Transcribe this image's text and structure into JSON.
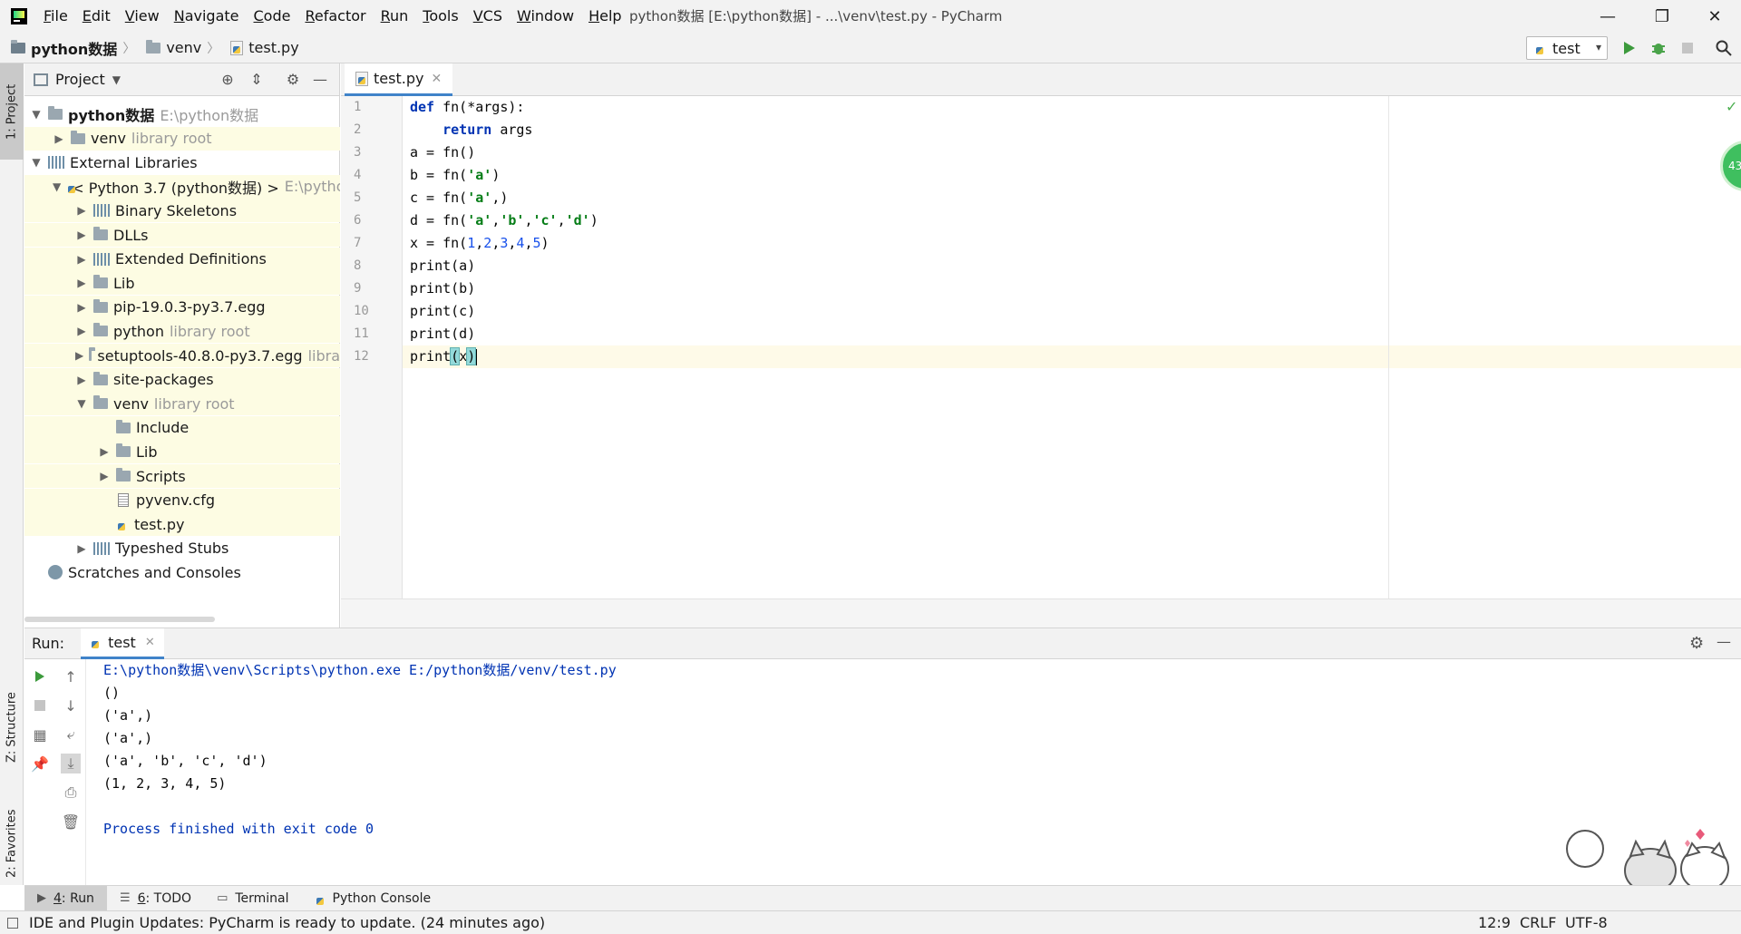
{
  "window": {
    "title": "python数据 [E:\\python数据] - ...\\venv\\test.py - PyCharm",
    "menu": [
      {
        "label_u": "F",
        "label_rest": "ile"
      },
      {
        "label_u": "E",
        "label_rest": "dit"
      },
      {
        "label_u": "V",
        "label_rest": "iew"
      },
      {
        "label_u": "N",
        "label_rest": "avigate"
      },
      {
        "label_u": "C",
        "label_rest": "ode"
      },
      {
        "label_u": "R",
        "label_rest": "efactor"
      },
      {
        "label_u": "R",
        "label_rest": "un"
      },
      {
        "label_u": "T",
        "label_rest": "ools"
      },
      {
        "label_u": "V",
        "label_rest": "CS"
      },
      {
        "label_u": "W",
        "label_rest": "indow"
      },
      {
        "label_u": "H",
        "label_rest": "elp"
      }
    ],
    "controls": {
      "minimize": "—",
      "restore": "❐",
      "close": "✕"
    }
  },
  "navbar": {
    "crumbs": [
      "python数据",
      "venv",
      "test.py"
    ],
    "run_config": "test",
    "icons": [
      "run-icon",
      "debug-icon",
      "stop-icon",
      "search-icon"
    ]
  },
  "left_strip": {
    "project": "1: Project",
    "structure": "Z: Structure",
    "favorites": "2: Favorites"
  },
  "project_panel": {
    "title": "Project",
    "tree": [
      {
        "name": "python数据",
        "hint": "E:\\python数据",
        "icon": "folder",
        "chev": "open"
      },
      {
        "name": "venv",
        "hint": "library root",
        "icon": "folder",
        "chev": "closed"
      },
      {
        "name": "External Libraries",
        "hint": "",
        "icon": "library",
        "chev": "open"
      },
      {
        "name": "< Python 3.7 (python数据) >",
        "hint": "E:\\pytho",
        "icon": "python",
        "chev": "open"
      },
      {
        "name": "Binary Skeletons",
        "hint": "",
        "icon": "library",
        "chev": "closed"
      },
      {
        "name": "DLLs",
        "hint": "",
        "icon": "folder",
        "chev": "closed"
      },
      {
        "name": "Extended Definitions",
        "hint": "",
        "icon": "library",
        "chev": "closed"
      },
      {
        "name": "Lib",
        "hint": "",
        "icon": "folder",
        "chev": "closed"
      },
      {
        "name": "pip-19.0.3-py3.7.egg",
        "hint": "",
        "icon": "folder",
        "chev": "closed"
      },
      {
        "name": "python",
        "hint": "library root",
        "icon": "folder",
        "chev": "closed"
      },
      {
        "name": "setuptools-40.8.0-py3.7.egg",
        "hint": "libra",
        "icon": "folder",
        "chev": "closed"
      },
      {
        "name": "site-packages",
        "hint": "",
        "icon": "folder",
        "chev": "closed"
      },
      {
        "name": "venv",
        "hint": "library root",
        "icon": "folder",
        "chev": "open"
      },
      {
        "name": "Include",
        "hint": "",
        "icon": "folder",
        "chev": "none"
      },
      {
        "name": "Lib",
        "hint": "",
        "icon": "folder",
        "chev": "closed"
      },
      {
        "name": "Scripts",
        "hint": "",
        "icon": "folder",
        "chev": "closed"
      },
      {
        "name": "pyvenv.cfg",
        "hint": "",
        "icon": "cfg",
        "chev": "none"
      },
      {
        "name": "test.py",
        "hint": "",
        "icon": "python",
        "chev": "none"
      },
      {
        "name": "Typeshed Stubs",
        "hint": "",
        "icon": "library",
        "chev": "closed"
      },
      {
        "name": "Scratches and Consoles",
        "hint": "",
        "icon": "scratch",
        "chev": "none"
      }
    ]
  },
  "editor": {
    "tab": "test.py",
    "line_numbers": [
      "1",
      "2",
      "3",
      "4",
      "5",
      "6",
      "7",
      "8",
      "9",
      "10",
      "11",
      "12"
    ],
    "cursor": "12:9"
  },
  "run_panel": {
    "label": "Run:",
    "tab": "test",
    "output": [
      "E:\\python数据\\venv\\Scripts\\python.exe E:/python数据/venv/test.py",
      "()",
      "('a',)",
      "('a',)",
      "('a', 'b', 'c', 'd')",
      "(1, 2, 3, 4, 5)",
      "",
      "Process finished with exit code 0"
    ]
  },
  "bottom_tabs": [
    {
      "key": "4",
      "label": ": Run"
    },
    {
      "key": "6",
      "label": ": TODO"
    },
    {
      "key": "",
      "label": "Terminal"
    },
    {
      "key": "",
      "label": "Python Console"
    }
  ],
  "statusbar": {
    "message": "IDE and Plugin Updates: PyCharm is ready to update. (24 minutes ago)",
    "position": "12:9",
    "line_sep": "CRLF",
    "encoding": "UTF-8"
  },
  "badge": "43"
}
